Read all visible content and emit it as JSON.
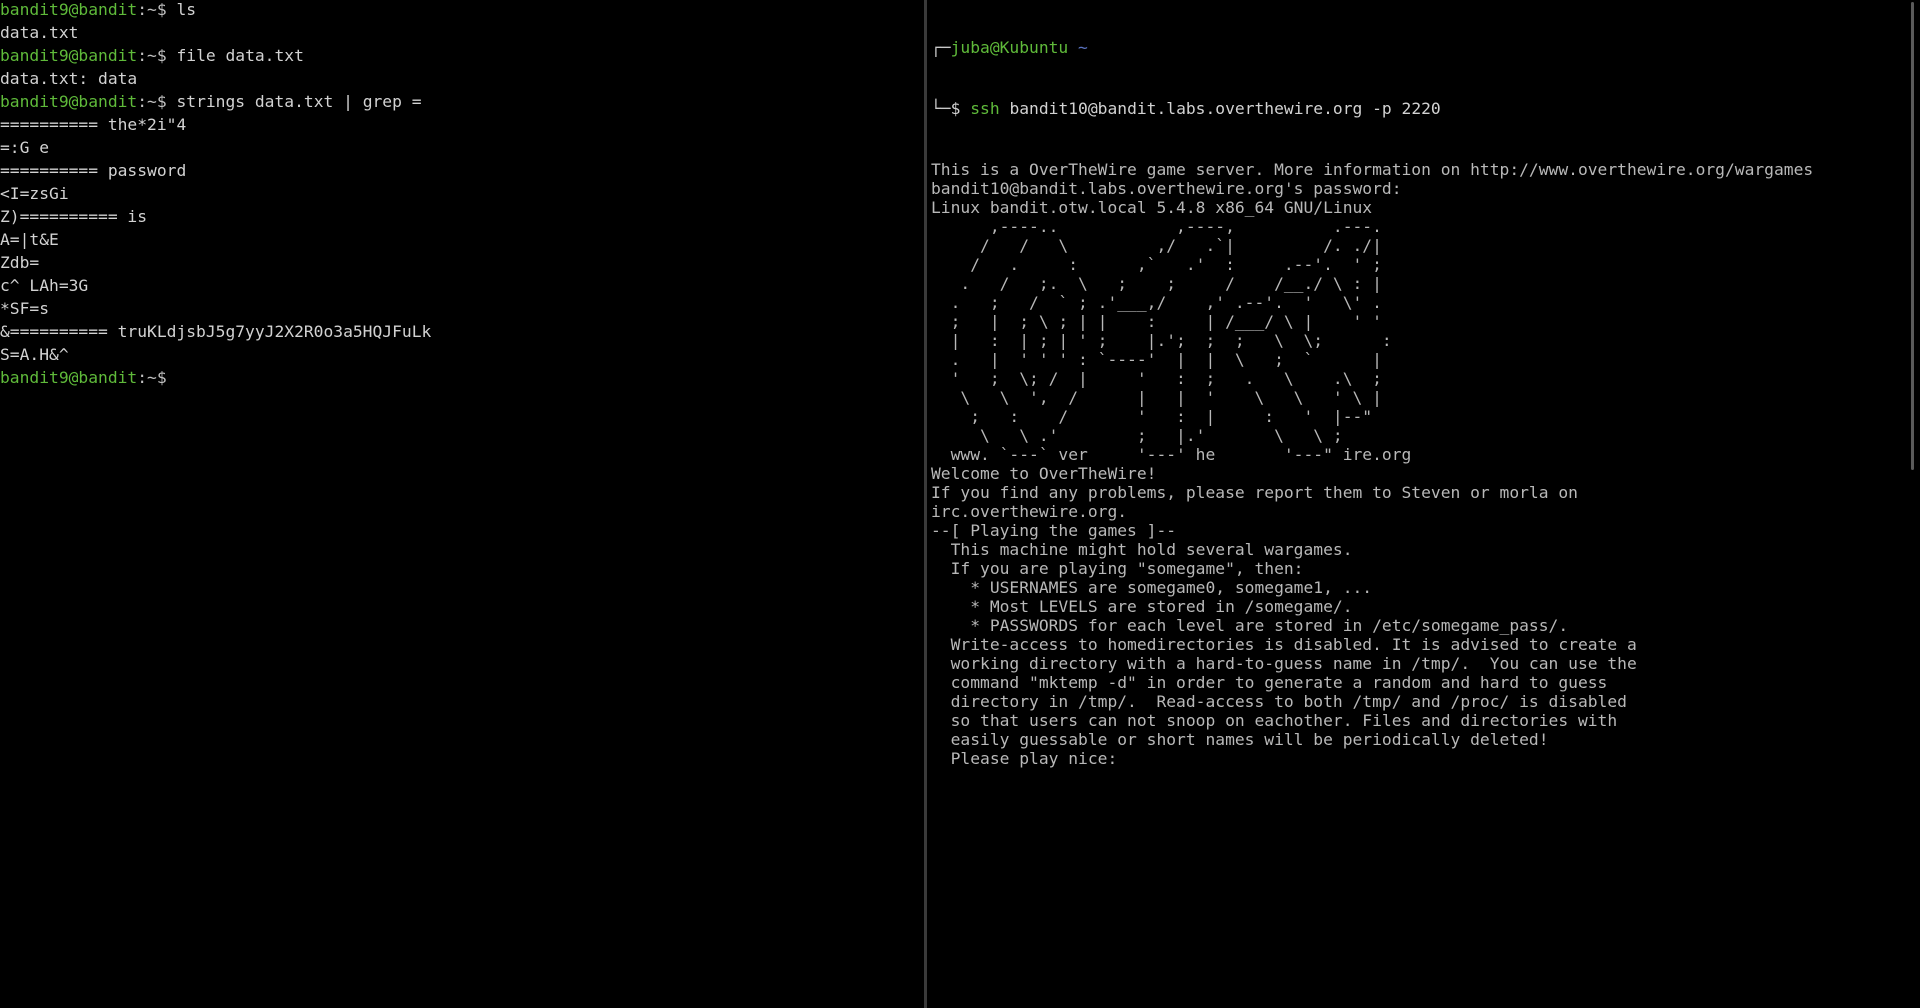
{
  "left_terminal": {
    "prompt_user_host": "bandit9@bandit",
    "prompt_suffix": ":~$",
    "lines": [
      {
        "type": "prompt",
        "command": " ls"
      },
      {
        "type": "output",
        "text": "data.txt"
      },
      {
        "type": "prompt",
        "command": " file data.txt"
      },
      {
        "type": "output",
        "text": "data.txt: data"
      },
      {
        "type": "prompt",
        "command": " strings data.txt | grep ="
      },
      {
        "type": "output",
        "text": "========== the*2i\"4"
      },
      {
        "type": "output",
        "text": "=:G e"
      },
      {
        "type": "output",
        "text": "========== password"
      },
      {
        "type": "output",
        "text": "<I=zsGi"
      },
      {
        "type": "output",
        "text": "Z)========== is"
      },
      {
        "type": "output",
        "text": "A=|t&E"
      },
      {
        "type": "output",
        "text": "Zdb="
      },
      {
        "type": "output",
        "text": "c^ LAh=3G"
      },
      {
        "type": "output",
        "text": "*SF=s"
      },
      {
        "type": "output",
        "text": "&========== truKLdjsbJ5g7yyJ2X2R0o3a5HQJFuLk"
      },
      {
        "type": "output",
        "text": "S=A.H&^"
      },
      {
        "type": "prompt",
        "command": ""
      }
    ]
  },
  "right_terminal": {
    "zsh_prompt": {
      "box_top": "┌─",
      "user_host": "juba@Kubuntu",
      "dir": " ~",
      "box_bottom": "└─",
      "dollar": "$ ",
      "command_name": "ssh",
      "command_args": " bandit10@bandit.labs.overthewire.org -p 2220"
    },
    "lines": [
      "This is a OverTheWire game server. More information on http://www.overthewire.org/wargames",
      "",
      "bandit10@bandit.labs.overthewire.org's password:",
      "Linux bandit.otw.local 5.4.8 x86_64 GNU/Linux",
      "",
      "      ,----..            ,----,          .---.",
      "     /   /   \\         ,/   .`|         /. ./|",
      "    /   .     :      ,`   .'  :     .--'.  ' ;",
      "   .   /   ;.  \\   ;    ;     /    /__./ \\ : |",
      "  .   ;   /  ` ; .'___,/    ,' .--'.  '   \\' .",
      "  ;   |  ; \\ ; | |    :     | /___/ \\ |    ' '",
      "  |   :  | ; | ' ;    |.';  ;  ;   \\  \\;      :",
      "  .   |  ' ' ' : `----'  |  |  \\   ;  `      |",
      "  '   ;  \\; /  |     '   :  ;   .   \\    .\\  ;",
      "   \\   \\  ',  /      |   |  '    \\   \\   ' \\ |",
      "    ;   :    /       '   :  |     :   '  |--\"",
      "     \\   \\ .'        ;   |.'       \\   \\ ;",
      "  www. `---` ver     '---' he       '---\" ire.org",
      "",
      "",
      "Welcome to OverTheWire!",
      "",
      "If you find any problems, please report them to Steven or morla on",
      "irc.overthewire.org.",
      "",
      "--[ Playing the games ]--",
      "",
      "  This machine might hold several wargames.",
      "  If you are playing \"somegame\", then:",
      "",
      "    * USERNAMES are somegame0, somegame1, ...",
      "    * Most LEVELS are stored in /somegame/.",
      "    * PASSWORDS for each level are stored in /etc/somegame_pass/.",
      "",
      "  Write-access to homedirectories is disabled. It is advised to create a",
      "  working directory with a hard-to-guess name in /tmp/.  You can use the",
      "  command \"mktemp -d\" in order to generate a random and hard to guess",
      "  directory in /tmp/.  Read-access to both /tmp/ and /proc/ is disabled",
      "  so that users can not snoop on eachother. Files and directories with",
      "  easily guessable or short names will be periodically deleted!",
      "",
      "  Please play nice:"
    ]
  }
}
